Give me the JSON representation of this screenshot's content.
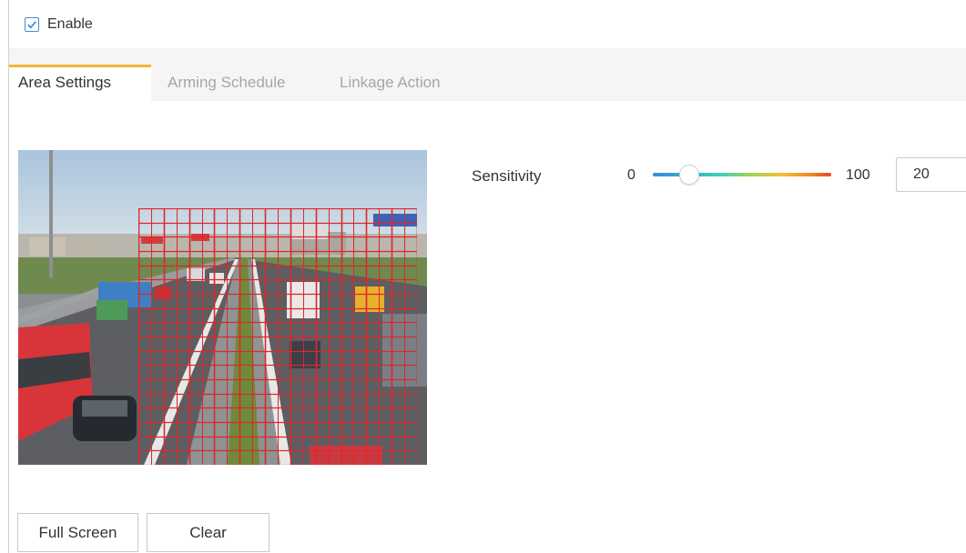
{
  "enable": {
    "label": "Enable",
    "checked": true
  },
  "tabs": [
    {
      "label": "Area Settings",
      "active": true
    },
    {
      "label": "Arming Schedule",
      "active": false
    },
    {
      "label": "Linkage Action",
      "active": false
    }
  ],
  "preview": {
    "grid_color": "#e0262b"
  },
  "sensitivity": {
    "label": "Sensitivity",
    "min": "0",
    "max": "100",
    "value": "20",
    "level_fraction": 0.2
  },
  "buttons": {
    "full_screen": "Full Screen",
    "clear": "Clear"
  },
  "colors": {
    "accent": "#f2b535",
    "checkbox": "#3d8ed8",
    "grid": "#e0262b"
  }
}
